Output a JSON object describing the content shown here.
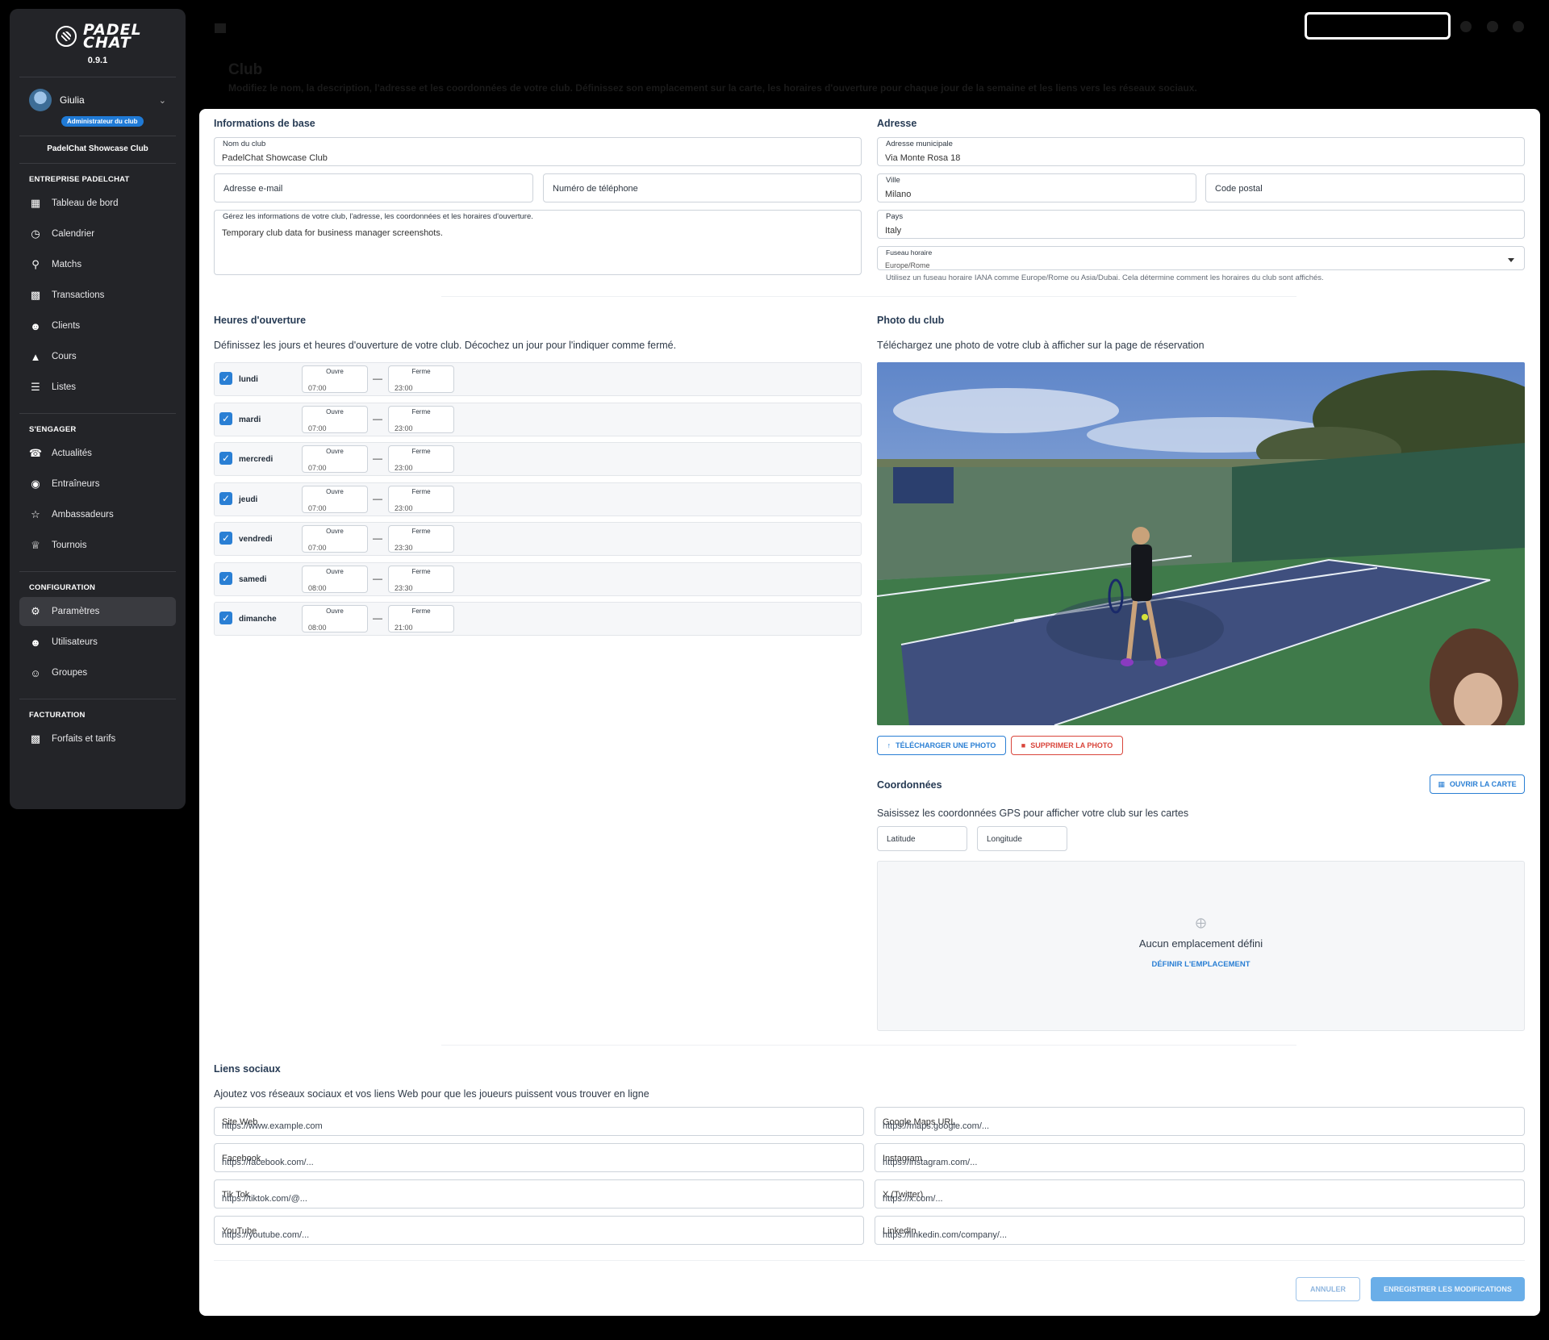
{
  "sidebar": {
    "brand": "PADEL CHAT",
    "version": "0.9.1",
    "user_name": "Giulia",
    "role_badge": "Administrateur du club",
    "club_name": "PadelChat Showcase Club",
    "sections": [
      {
        "title": "ENTREPRISE PADELCHAT",
        "items": [
          "Tableau de bord",
          "Calendrier",
          "Matchs",
          "Transactions",
          "Clients",
          "Cours",
          "Listes"
        ]
      },
      {
        "title": "S'ENGAGER",
        "items": [
          "Actualités",
          "Entraîneurs",
          "Ambassadeurs",
          "Tournois"
        ]
      },
      {
        "title": "CONFIGURATION",
        "items": [
          "Paramètres",
          "Utilisateurs",
          "Groupes"
        ]
      },
      {
        "title": "FACTURATION",
        "items": [
          "Forfaits et tarifs"
        ]
      }
    ],
    "active_item": "Paramètres"
  },
  "header": {
    "title": "Club",
    "description": "Modifiez le nom, la description, l'adresse et les coordonnées de votre club. Définissez son emplacement sur la carte, les horaires d'ouverture pour chaque jour de la semaine et les liens vers les réseaux sociaux."
  },
  "basic_info": {
    "title": "Informations de base",
    "club_name_label": "Nom du club",
    "club_name_value": "PadelChat Showcase Club",
    "email_placeholder": "Adresse e-mail",
    "phone_placeholder": "Numéro de téléphone",
    "description_label": "Gérez les informations de votre club, l'adresse, les coordonnées et les horaires d'ouverture.",
    "description_value": "Temporary club data for business manager screenshots."
  },
  "address": {
    "title": "Adresse",
    "street_label": "Adresse municipale",
    "street_value": "Via Monte Rosa 18",
    "city_label": "Ville",
    "city_value": "Milano",
    "postal_placeholder": "Code postal",
    "country_label": "Pays",
    "country_value": "Italy",
    "timezone_label": "Fuseau horaire",
    "timezone_value": "Europe/Rome",
    "timezone_helper": "Utilisez un fuseau horaire IANA comme Europe/Rome ou Asia/Dubai. Cela détermine comment les horaires du club sont affichés."
  },
  "hours": {
    "title": "Heures d'ouverture",
    "description": "Définissez les jours et heures d'ouverture de votre club. Décochez un jour pour l'indiquer comme fermé.",
    "open_label": "Ouvre",
    "close_label": "Ferme",
    "days": [
      {
        "name": "lundi",
        "open": "07:00",
        "close": "23:00",
        "checked": true
      },
      {
        "name": "mardi",
        "open": "07:00",
        "close": "23:00",
        "checked": true
      },
      {
        "name": "mercredi",
        "open": "07:00",
        "close": "23:00",
        "checked": true
      },
      {
        "name": "jeudi",
        "open": "07:00",
        "close": "23:00",
        "checked": true
      },
      {
        "name": "vendredi",
        "open": "07:00",
        "close": "23:30",
        "checked": true
      },
      {
        "name": "samedi",
        "open": "08:00",
        "close": "23:30",
        "checked": true
      },
      {
        "name": "dimanche",
        "open": "08:00",
        "close": "21:00",
        "checked": true
      }
    ]
  },
  "photo": {
    "title": "Photo du club",
    "description": "Téléchargez une photo de votre club à afficher sur la page de réservation",
    "upload_label": "TÉLÉCHARGER UNE PHOTO",
    "delete_label": "SUPPRIMER LA PHOTO"
  },
  "coords": {
    "title": "Coordonnées",
    "open_map_label": "OUVRIR LA CARTE",
    "description": "Saisissez les coordonnées GPS pour afficher votre club sur les cartes",
    "lat_placeholder": "Latitude",
    "lng_placeholder": "Longitude",
    "empty_text": "Aucun emplacement défini",
    "set_location_label": "DÉFINIR L'EMPLACEMENT"
  },
  "social": {
    "title": "Liens sociaux",
    "description": "Ajoutez vos réseaux sociaux et vos liens Web pour que les joueurs puissent vous trouver en ligne",
    "links": [
      {
        "label": "Site Web",
        "placeholder": "https://www.example.com"
      },
      {
        "label": "Google Maps URL",
        "placeholder": "https://maps.google.com/..."
      },
      {
        "label": "Facebook",
        "placeholder": "https://facebook.com/..."
      },
      {
        "label": "Instagram",
        "placeholder": "https://instagram.com/..."
      },
      {
        "label": "Tik Tok",
        "placeholder": "https://tiktok.com/@..."
      },
      {
        "label": "X (Twitter)",
        "placeholder": "https://x.com/..."
      },
      {
        "label": "YouTube",
        "placeholder": "https://youtube.com/..."
      },
      {
        "label": "LinkedIn",
        "placeholder": "https://linkedin.com/company/..."
      }
    ]
  },
  "actions": {
    "cancel_label": "ANNULER",
    "save_label": "ENREGISTRER LES MODIFICATIONS"
  },
  "colors": {
    "accent": "#2a7fd4",
    "danger": "#d9453b",
    "sidebar_bg": "#232428",
    "save_bg": "#6aaee8"
  }
}
